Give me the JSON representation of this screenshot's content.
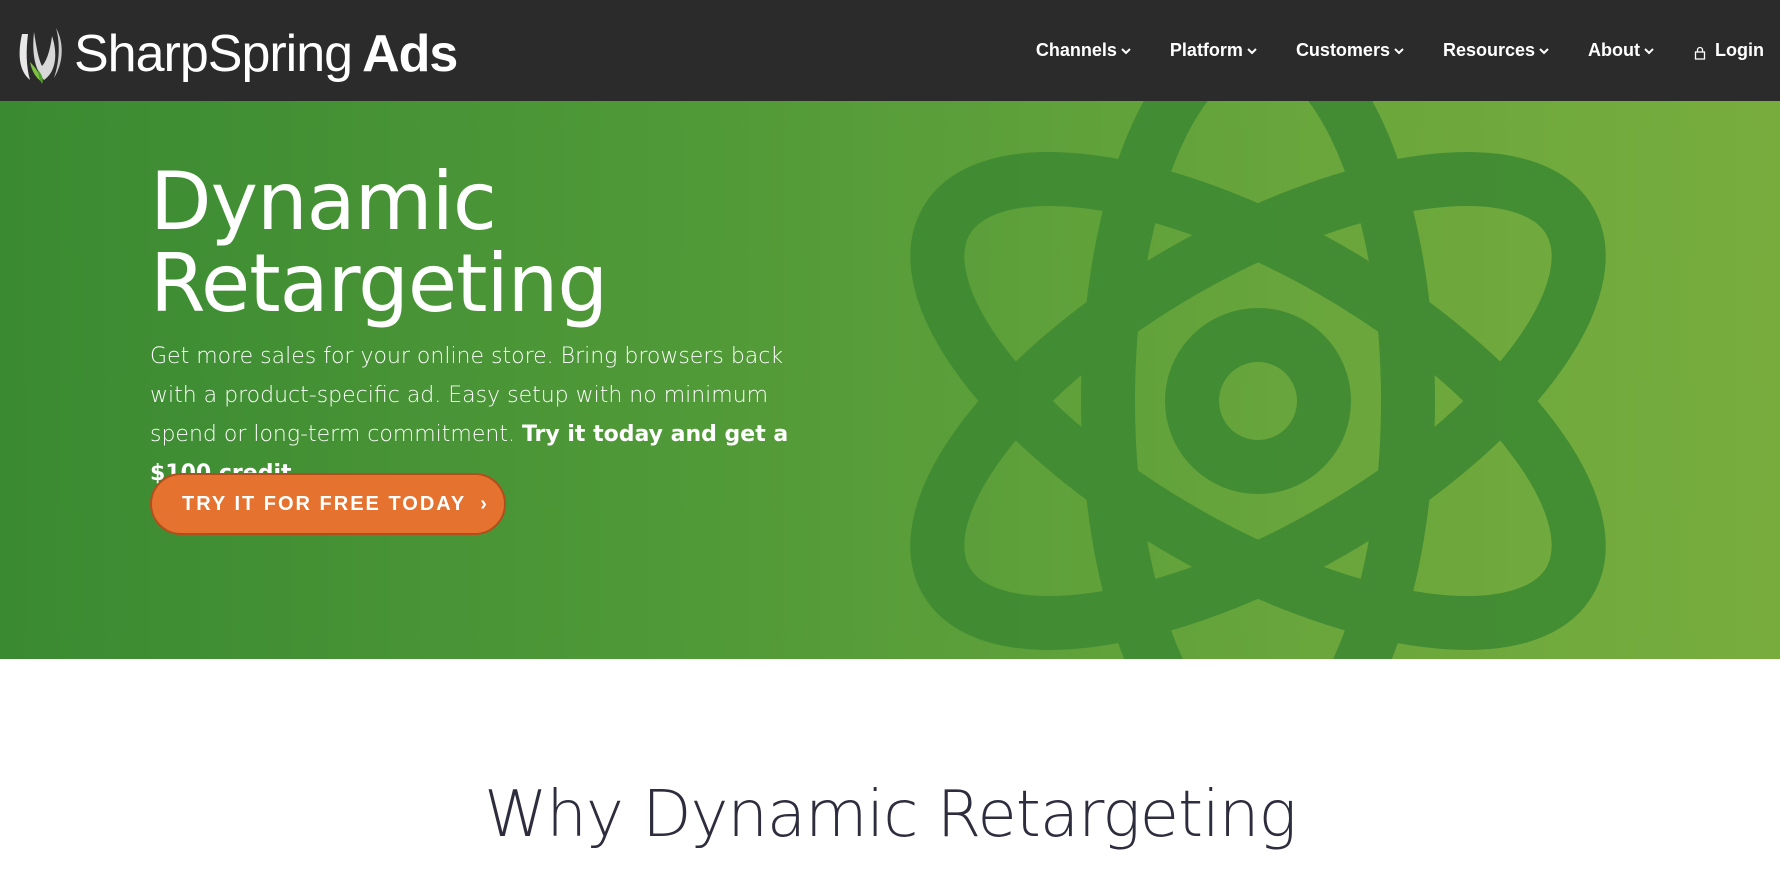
{
  "brand": {
    "name_light": "SharpSpring",
    "name_bold": "Ads"
  },
  "nav": {
    "items": [
      {
        "label": "Channels",
        "icon": "chevron-down-icon"
      },
      {
        "label": "Platform",
        "icon": "chevron-down-icon"
      },
      {
        "label": "Customers",
        "icon": "chevron-down-icon"
      },
      {
        "label": "Resources",
        "icon": "chevron-down-icon"
      },
      {
        "label": "About",
        "icon": "chevron-down-icon"
      }
    ],
    "login": {
      "label": "Login",
      "icon": "lock-icon"
    }
  },
  "hero": {
    "title_line1": "Dynamic",
    "title_line2": "Retargeting",
    "description": "Get more sales for your online store. Bring browsers back with a product-specific ad.  Easy setup with no minimum spend or long-term commitment. ",
    "description_bold": "Try it today and get a $100 credit.",
    "cta_label": "TRY IT FOR FREE TODAY",
    "cta_arrow": "›",
    "background_icon": "atom-icon"
  },
  "section": {
    "heading": "Why Dynamic Retargeting"
  },
  "colors": {
    "header_bg": "#2b2b2b",
    "hero_green_start": "#3a8a32",
    "hero_green_end": "#78ad3e",
    "atom_green": "#3f8a33",
    "cta_orange": "#e5722f",
    "heading_text": "#2e2d3d"
  }
}
